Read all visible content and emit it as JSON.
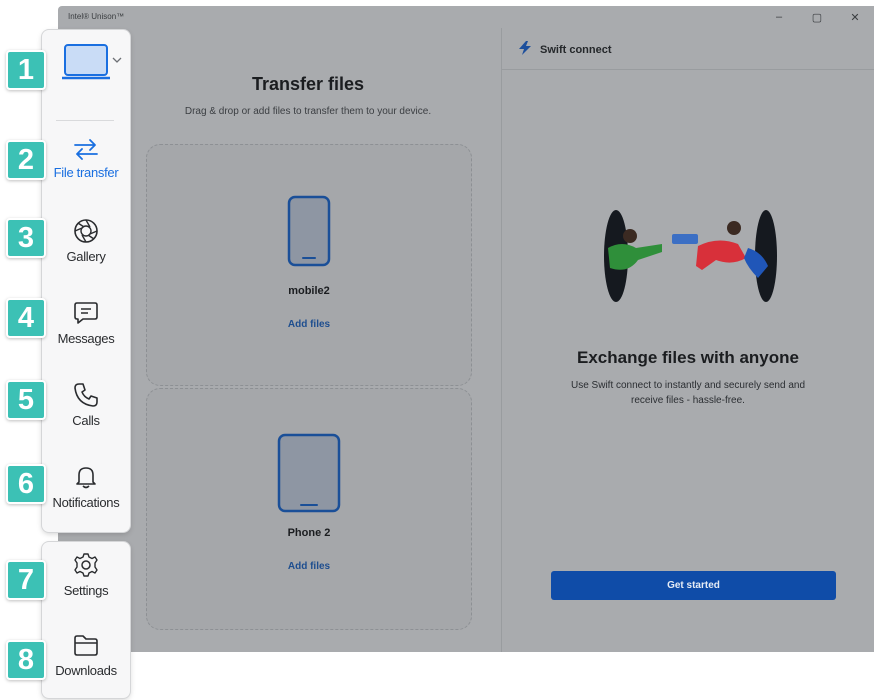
{
  "window": {
    "title": "Intel® Unison™",
    "controls": {
      "minimize": "–",
      "maximize": "▢",
      "close": "✕"
    }
  },
  "transfer": {
    "title": "Transfer files",
    "subtitle": "Drag & drop or add files to transfer them to your device.",
    "devices": [
      {
        "name": "mobile2",
        "type": "phone",
        "action": "Add files"
      },
      {
        "name": "Phone 2",
        "type": "tablet",
        "action": "Add files"
      }
    ]
  },
  "swift": {
    "header": "Swift connect",
    "heading": "Exchange files with anyone",
    "description": "Use Swift connect to instantly and securely send and receive files - hassle-free.",
    "button": "Get started"
  },
  "nav": {
    "items": [
      {
        "label": "File transfer",
        "icon": "arrows-swap-icon",
        "active": true
      },
      {
        "label": "Gallery",
        "icon": "aperture-icon",
        "active": false
      },
      {
        "label": "Messages",
        "icon": "message-icon",
        "active": false
      },
      {
        "label": "Calls",
        "icon": "phone-icon",
        "active": false
      },
      {
        "label": "Notifications",
        "icon": "bell-icon",
        "active": false
      }
    ],
    "bottom": [
      {
        "label": "Settings",
        "icon": "gear-icon"
      },
      {
        "label": "Downloads",
        "icon": "folder-icon"
      }
    ]
  },
  "badges": [
    "1",
    "2",
    "3",
    "4",
    "5",
    "6",
    "7",
    "8"
  ],
  "colors": {
    "accent": "#1a6fe0",
    "badge": "#3cc1b5",
    "button": "#0f4ca8",
    "overlay": "#a9abae"
  }
}
